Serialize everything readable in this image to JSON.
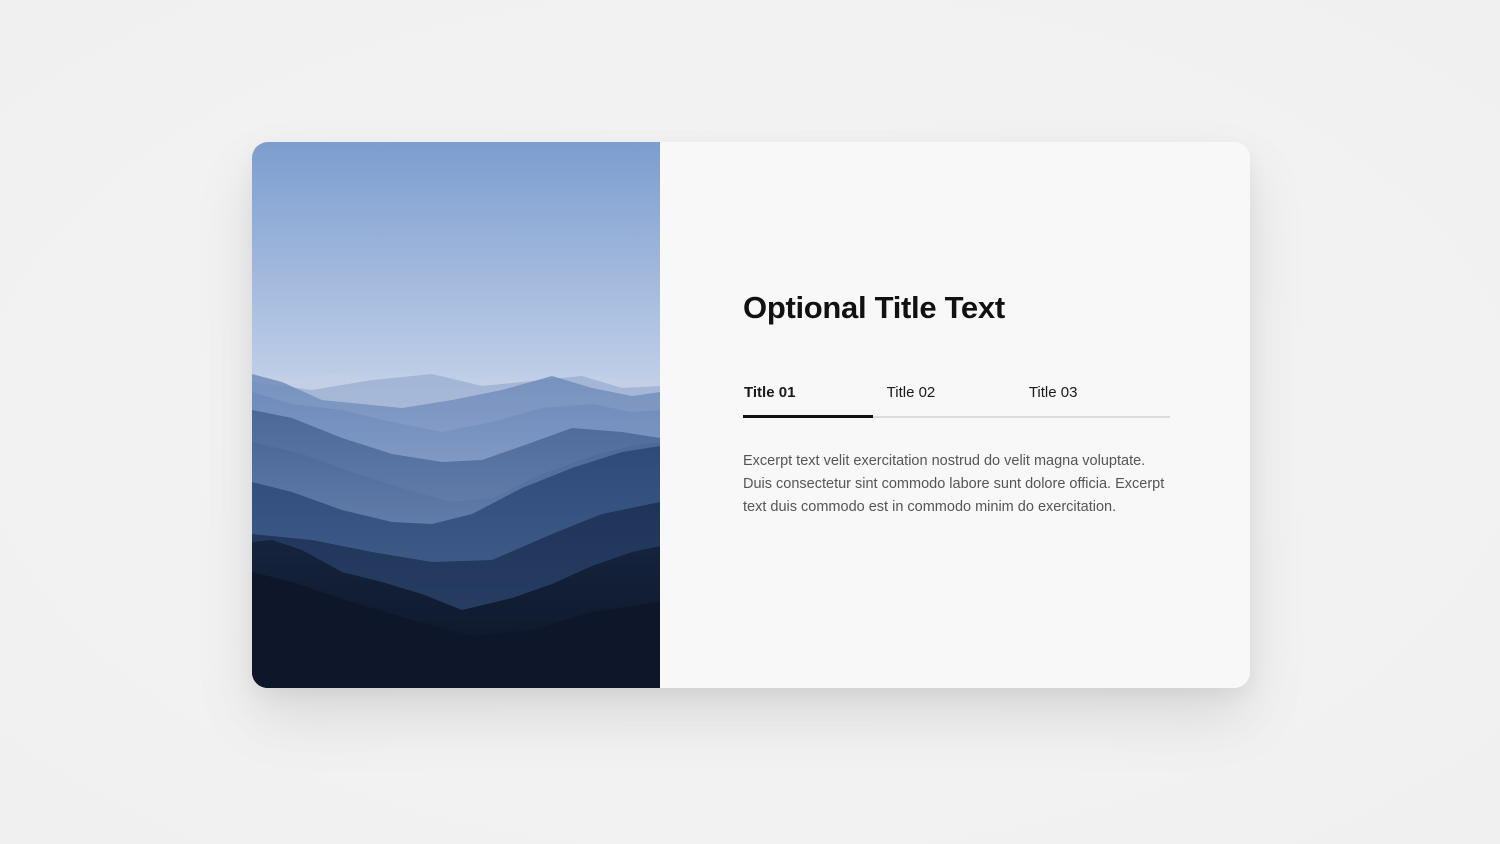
{
  "card": {
    "image": {
      "description_icon": "mountain-landscape-image",
      "colors": {
        "sky_top": "#7f9fd0",
        "sky_bottom": "#e4e9f3",
        "ridge_far": "#aabbd6",
        "ridge_mid": "#5d7bab",
        "ridge_near": "#2c4672",
        "ridge_darkest": "#111c30"
      }
    },
    "title": "Optional Title Text",
    "tabs": [
      {
        "label": "Title 01",
        "active": true
      },
      {
        "label": "Title 02",
        "active": false
      },
      {
        "label": "Title 03",
        "active": false
      }
    ],
    "excerpt": "Excerpt text velit exercitation nostrud do velit magna voluptate. Duis consectetur sint commodo labore sunt dolore officia. Excerpt text duis commodo est in commodo minim do exercitation.",
    "colors": {
      "title": "#111111",
      "tab_active_indicator": "#111111",
      "tab_track": "#dcdcdc",
      "excerpt": "#555555",
      "card_bg": "#f8f8f8"
    }
  }
}
